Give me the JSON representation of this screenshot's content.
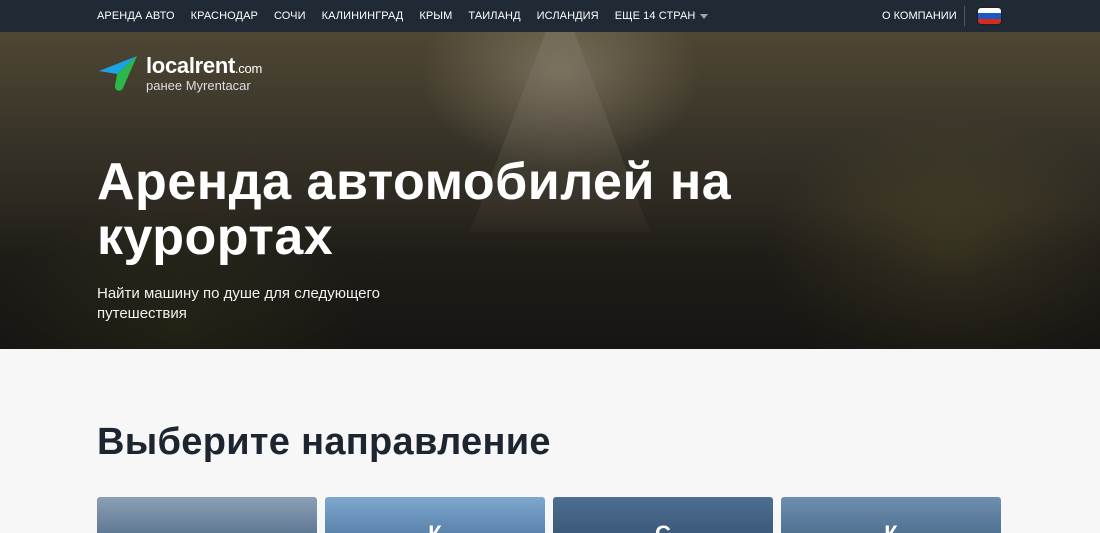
{
  "nav": {
    "links": [
      {
        "label": "АРЕНДА АВТО"
      },
      {
        "label": "КРАСНОДАР"
      },
      {
        "label": "СОЧИ"
      },
      {
        "label": "КАЛИНИНГРАД"
      },
      {
        "label": "КРЫМ"
      },
      {
        "label": "ТАИЛАНД"
      },
      {
        "label": "ИСЛАНДИЯ"
      }
    ],
    "more_label": "ЕЩЕ 14 СТРАН",
    "about_label": "О КОМПАНИИ",
    "flag_colors": [
      "#ffffff",
      "#1c57c4",
      "#d52b1e"
    ]
  },
  "logo": {
    "name": "localrent",
    "suffix": ".com",
    "subtitle": "ранее Myrentacar",
    "colors": {
      "blue": "#1aa4e6",
      "green": "#2ab84a"
    }
  },
  "hero": {
    "title": "Аренда автомобилей на курортах",
    "subtitle": "Найти машину по душе для следующего путешествия"
  },
  "section": {
    "title": "Выберите направление"
  },
  "cards": [
    {
      "glyph": "",
      "color_top": "#8aa0b5",
      "color_bottom": "#5c7590"
    },
    {
      "glyph": "К",
      "color_top": "#7fa8cf",
      "color_bottom": "#577fa8"
    },
    {
      "glyph": "С",
      "color_top": "#4d6e92",
      "color_bottom": "#3a5878"
    },
    {
      "glyph": "К",
      "color_top": "#6f8fb0",
      "color_bottom": "#4e6e8e"
    }
  ]
}
